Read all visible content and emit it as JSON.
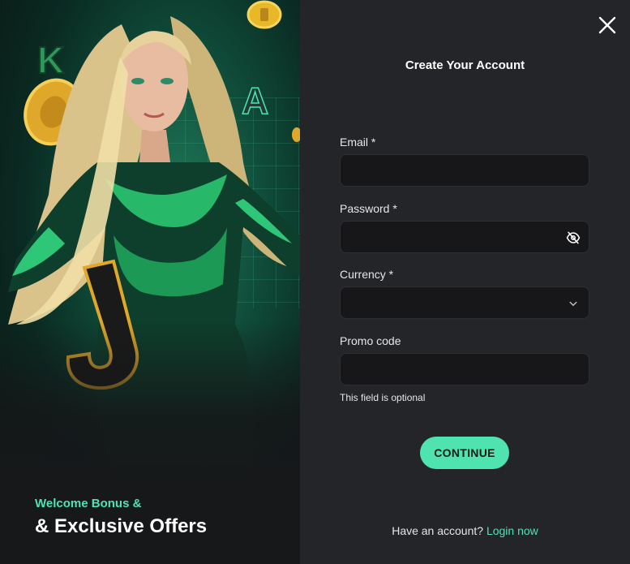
{
  "promo": {
    "welcome_line": "Welcome Bonus &",
    "offers_line": "& Exclusive Offers",
    "art_icon": "hero-character-illustration",
    "letters": [
      "K",
      "A",
      "J"
    ]
  },
  "form": {
    "title": "Create Your Account",
    "close_icon": "close-icon",
    "email": {
      "label": "Email *",
      "value": ""
    },
    "password": {
      "label": "Password *",
      "value": "",
      "toggle_icon": "eye-off-icon"
    },
    "currency": {
      "label": "Currency *",
      "value": "",
      "dropdown_icon": "chevron-down-icon"
    },
    "promo_code": {
      "label": "Promo code",
      "value": "",
      "hint": "This field is optional"
    },
    "continue_label": "CONTINUE",
    "footer_text": "Have an account?",
    "login_link": "Login now"
  },
  "colors": {
    "accent": "#4fe3b0",
    "panel_bg": "#242528",
    "field_bg": "#17171a"
  }
}
